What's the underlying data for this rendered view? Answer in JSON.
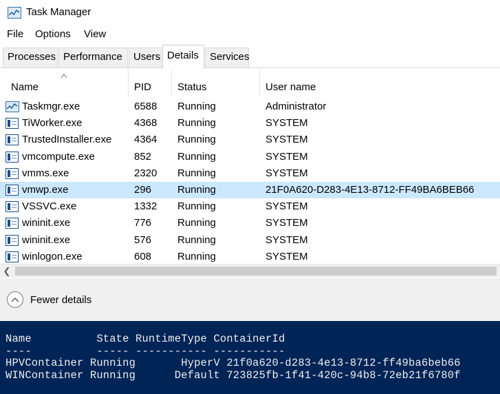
{
  "window": {
    "title": "Task Manager"
  },
  "menu": {
    "file": "File",
    "options": "Options",
    "view": "View"
  },
  "tabs": [
    {
      "label": "Processes"
    },
    {
      "label": "Performance"
    },
    {
      "label": "Users"
    },
    {
      "label": "Details"
    },
    {
      "label": "Services"
    }
  ],
  "active_tab": "Details",
  "grid": {
    "columns": {
      "name": "Name",
      "pid": "PID",
      "status": "Status",
      "user": "User name"
    },
    "sorted_column": "Name",
    "rows": [
      {
        "name": "Taskmgr.exe",
        "pid": "6588",
        "status": "Running",
        "user": "Administrator",
        "icon": "task-manager-icon"
      },
      {
        "name": "TiWorker.exe",
        "pid": "4368",
        "status": "Running",
        "user": "SYSTEM",
        "icon": "process-icon"
      },
      {
        "name": "TrustedInstaller.exe",
        "pid": "4364",
        "status": "Running",
        "user": "SYSTEM",
        "icon": "process-icon"
      },
      {
        "name": "vmcompute.exe",
        "pid": "852",
        "status": "Running",
        "user": "SYSTEM",
        "icon": "process-icon"
      },
      {
        "name": "vmms.exe",
        "pid": "2320",
        "status": "Running",
        "user": "SYSTEM",
        "icon": "process-icon"
      },
      {
        "name": "vmwp.exe",
        "pid": "296",
        "status": "Running",
        "user": "21F0A620-D283-4E13-8712-FF49BA6BEB66",
        "icon": "process-icon",
        "selected": true
      },
      {
        "name": "VSSVC.exe",
        "pid": "1332",
        "status": "Running",
        "user": "SYSTEM",
        "icon": "process-icon"
      },
      {
        "name": "wininit.exe",
        "pid": "776",
        "status": "Running",
        "user": "SYSTEM",
        "icon": "process-icon"
      },
      {
        "name": "wininit.exe",
        "pid": "576",
        "status": "Running",
        "user": "SYSTEM",
        "icon": "process-icon"
      },
      {
        "name": "winlogon.exe",
        "pid": "608",
        "status": "Running",
        "user": "SYSTEM",
        "icon": "process-icon"
      }
    ]
  },
  "footer": {
    "fewer_details": "Fewer details"
  },
  "powershell": {
    "lines": [
      "Name          State RuntimeType ContainerId",
      "----          ----- ----------- -----------",
      "HPVContainer Running       HyperV 21f0a620-d283-4e13-8712-ff49ba6beb66",
      "WINContainer Running      Default 723825fb-1f41-420c-94b8-72eb21f6780f"
    ]
  },
  "colors": {
    "selected_row": "#cce8ff",
    "powershell_bg": "#012456",
    "powershell_fg": "#eeedf0"
  }
}
